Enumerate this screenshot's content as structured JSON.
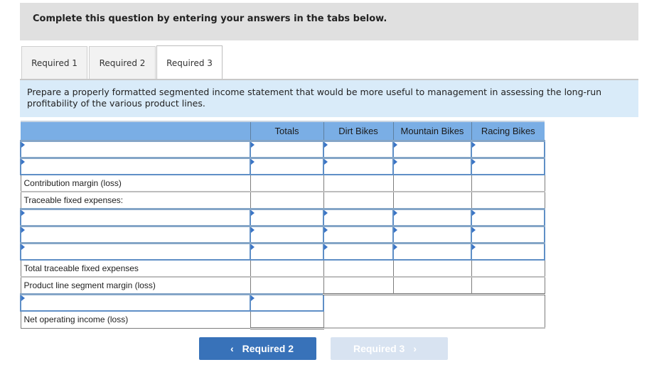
{
  "instruction": "Complete this question by entering your answers in the tabs below.",
  "tabs": [
    {
      "label": "Required 1",
      "active": false
    },
    {
      "label": "Required 2",
      "active": false
    },
    {
      "label": "Required 3",
      "active": true
    }
  ],
  "prompt": "Prepare a properly formatted segmented income statement that would be more useful to management in assessing the long-run profitability of the various product lines.",
  "table": {
    "columns": [
      "",
      "Totals",
      "Dirt Bikes",
      "Mountain Bikes",
      "Racing Bikes"
    ],
    "rows": [
      {
        "type": "input",
        "label": "",
        "values": [
          "",
          "",
          "",
          ""
        ]
      },
      {
        "type": "input",
        "label": "",
        "values": [
          "",
          "",
          "",
          ""
        ]
      },
      {
        "type": "static",
        "label": "Contribution margin (loss)",
        "values": [
          "",
          "",
          "",
          ""
        ]
      },
      {
        "type": "static",
        "label": "Traceable fixed expenses:",
        "values": [
          "",
          "",
          "",
          ""
        ]
      },
      {
        "type": "input",
        "label": "",
        "values": [
          "",
          "",
          "",
          ""
        ]
      },
      {
        "type": "input",
        "label": "",
        "values": [
          "",
          "",
          "",
          ""
        ]
      },
      {
        "type": "input",
        "label": "",
        "values": [
          "",
          "",
          "",
          ""
        ]
      },
      {
        "type": "static",
        "label": "Total traceable fixed expenses",
        "values": [
          "",
          "",
          "",
          ""
        ]
      },
      {
        "type": "static",
        "label": "Product line segment margin (loss)",
        "values": [
          "",
          "",
          "",
          ""
        ]
      },
      {
        "type": "input-total-only",
        "label": "",
        "values": [
          ""
        ]
      },
      {
        "type": "static-total-only",
        "label": "Net operating income (loss)",
        "values": [
          ""
        ]
      }
    ]
  },
  "nav": {
    "prev_label": "Required 2",
    "next_label": "Required 3",
    "prev_icon": "chevron-left-icon",
    "next_icon": "chevron-right-icon",
    "next_disabled": true
  },
  "colors": {
    "header_bg": "#7aaee5",
    "prompt_bg": "#d9ebf9",
    "instruction_bg": "#e0e0e0",
    "prev_button": "#3872b9",
    "next_button_disabled": "#d8e3f1",
    "input_border": "#5f8fc6"
  }
}
